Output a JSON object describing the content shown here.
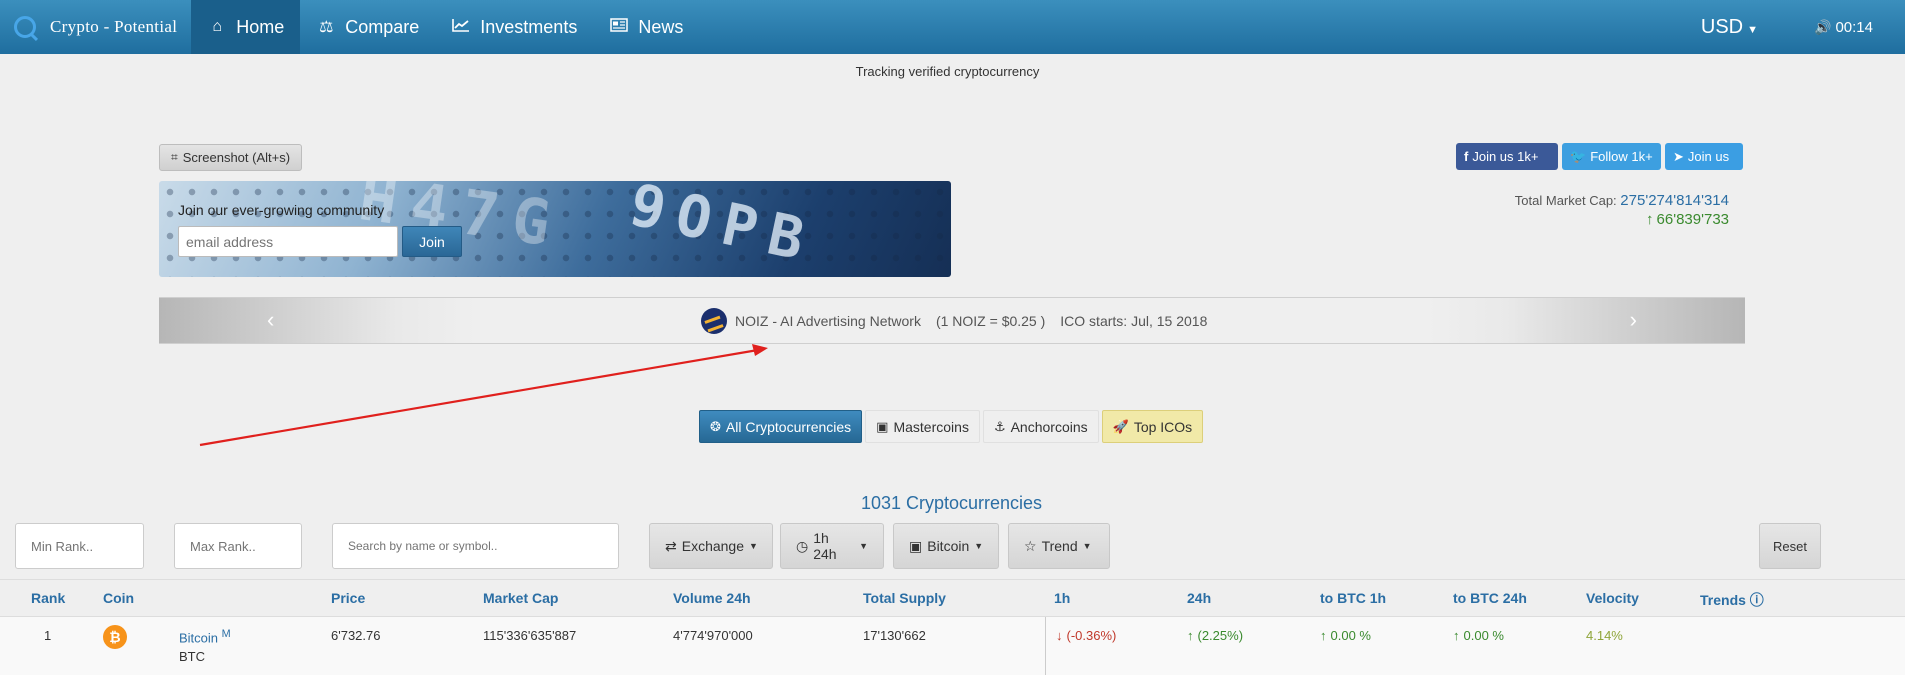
{
  "nav": {
    "brand": "Crypto - Potential",
    "items": [
      {
        "label": "Home",
        "icon": "home-icon",
        "active": true
      },
      {
        "label": "Compare",
        "icon": "scale-icon",
        "active": false
      },
      {
        "label": "Investments",
        "icon": "line-chart-icon",
        "active": false
      },
      {
        "label": "News",
        "icon": "newspaper-icon",
        "active": false
      }
    ],
    "currency": "USD",
    "time": "00:14"
  },
  "tagline": "Tracking verified cryptocurrency",
  "screenshot_button": "Screenshot (Alt+s)",
  "community": {
    "label": "Join our ever-growing community",
    "email_placeholder": "email address",
    "join_label": "Join"
  },
  "social": {
    "facebook": "Join us 1k+",
    "twitter": "Follow 1k+",
    "telegram": "Join us"
  },
  "market_cap": {
    "label": "Total Market Cap:",
    "value": "275'274'814'314",
    "change": "66'839'733"
  },
  "ico": {
    "name": "NOIZ - AI Advertising Network",
    "rate": "(1 NOIZ = $0.25 )",
    "start": "ICO starts: Jul, 15 2018"
  },
  "tabs": [
    {
      "label": "All Cryptocurrencies",
      "icon": "coins-icon"
    },
    {
      "label": "Mastercoins",
      "icon": "cube-icon"
    },
    {
      "label": "Anchorcoins",
      "icon": "anchor-icon"
    },
    {
      "label": "Top ICOs",
      "icon": "rocket-icon"
    }
  ],
  "count_label": "1031 Cryptocurrencies",
  "filters": {
    "min_rank_placeholder": "Min Rank..",
    "max_rank_placeholder": "Max Rank..",
    "search_placeholder": "Search by name or symbol..",
    "exchange": "Exchange",
    "timeframe": "1h 24h",
    "base": "Bitcoin",
    "trend": "Trend",
    "reset": "Reset"
  },
  "table": {
    "headers": [
      "Rank",
      "Coin",
      "Price",
      "Market Cap",
      "Volume 24h",
      "Total Supply",
      "1h",
      "24h",
      "to BTC 1h",
      "to BTC 24h",
      "Velocity",
      "Trends"
    ],
    "rows": [
      {
        "rank": "1",
        "name": "Bitcoin",
        "badge": "M",
        "symbol": "BTC",
        "price": "6'732.76",
        "market_cap": "115'336'635'887",
        "volume": "4'774'970'000",
        "supply": "17'130'662",
        "h1": "(-0.36%)",
        "h24": "(2.25%)",
        "btc_1h": "0.00 %",
        "btc_24h": "0.00 %",
        "velocity": "4.14%"
      }
    ]
  },
  "colors": {
    "nav": "#1f6e9f",
    "accent": "#2b6ea4",
    "positive": "#3a8a2e",
    "negative": "#c0392b"
  }
}
